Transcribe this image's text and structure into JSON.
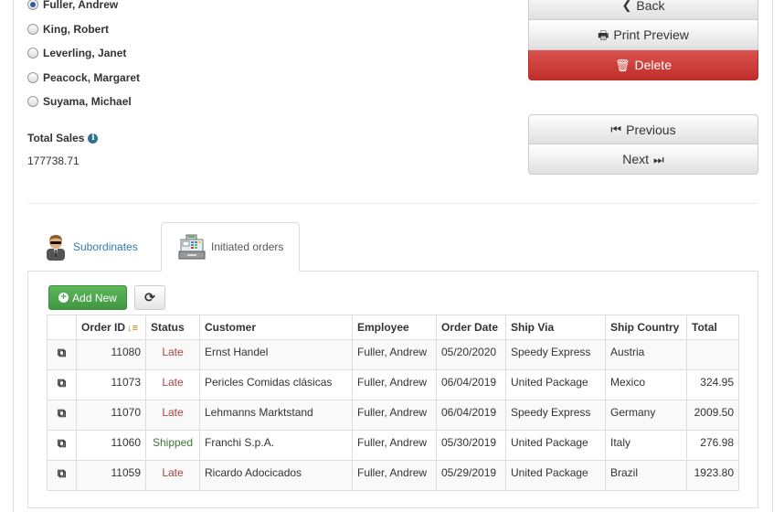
{
  "employees": {
    "selected": "Fuller, Andrew",
    "items": [
      {
        "name": "Fuller, Andrew",
        "checked": true
      },
      {
        "name": "King, Robert",
        "checked": false
      },
      {
        "name": "Leverling, Janet",
        "checked": false
      },
      {
        "name": "Peacock, Margaret",
        "checked": false
      },
      {
        "name": "Suyama, Michael",
        "checked": false
      }
    ]
  },
  "total_sales": {
    "label": "Total Sales",
    "info_icon": "info-circle-icon",
    "value": "177738.71"
  },
  "actions": {
    "back": {
      "label": "Back",
      "icon": "chevron-left-icon",
      "glyph": "❮"
    },
    "print_preview": {
      "label": "Print Preview",
      "icon": "print-icon",
      "glyph": "🖶"
    },
    "delete": {
      "label": "Delete",
      "icon": "trash-icon",
      "glyph": "🗑"
    },
    "previous": {
      "label": "Previous",
      "icon": "step-backward-icon",
      "glyph": "⏮"
    },
    "next": {
      "label": "Next",
      "icon": "step-forward-icon",
      "glyph": "⏭"
    }
  },
  "tabs": [
    {
      "label": "Subordinates",
      "icon": "agent-person-icon",
      "active": false
    },
    {
      "label": "Initiated orders",
      "icon": "cash-register-icon",
      "active": true
    }
  ],
  "toolbar": {
    "add_new_label": "Add New",
    "add_icon": "plus-circle-icon",
    "refresh_icon": "refresh-icon",
    "refresh_glyph": "⟳"
  },
  "colors": {
    "danger": "#d9534f",
    "success": "#5cb85c",
    "link": "#337ab7",
    "late": "#a94442",
    "shipped": "#3c763d",
    "sort_icon": "#c87f0a"
  },
  "grid": {
    "columns": [
      "",
      "Order ID",
      "Status",
      "Customer",
      "Employee",
      "Order Date",
      "Ship Via",
      "Ship Country",
      "Total"
    ],
    "sort_column": "Order ID",
    "sort_direction": "descending",
    "rows": [
      {
        "order_id": "11080",
        "status": "Late",
        "customer": "Ernst Handel",
        "employee": "Fuller, Andrew",
        "order_date": "05/20/2020",
        "ship_via": "Speedy Express",
        "ship_country": "Austria",
        "total": ""
      },
      {
        "order_id": "11073",
        "status": "Late",
        "customer": "Pericles Comidas clásicas",
        "employee": "Fuller, Andrew",
        "order_date": "06/04/2019",
        "ship_via": "United Package",
        "ship_country": "Mexico",
        "total": "324.95"
      },
      {
        "order_id": "11070",
        "status": "Late",
        "customer": "Lehmanns Marktstand",
        "employee": "Fuller, Andrew",
        "order_date": "06/04/2019",
        "ship_via": "Speedy Express",
        "ship_country": "Germany",
        "total": "2009.50"
      },
      {
        "order_id": "11060",
        "status": "Shipped",
        "customer": "Franchi S.p.A.",
        "employee": "Fuller, Andrew",
        "order_date": "05/30/2019",
        "ship_via": "United Package",
        "ship_country": "Italy",
        "total": "276.98"
      },
      {
        "order_id": "11059",
        "status": "Late",
        "customer": "Ricardo Adocicados",
        "employee": "Fuller, Andrew",
        "order_date": "05/29/2019",
        "ship_via": "United Package",
        "ship_country": "Brazil",
        "total": "1923.80"
      }
    ]
  }
}
